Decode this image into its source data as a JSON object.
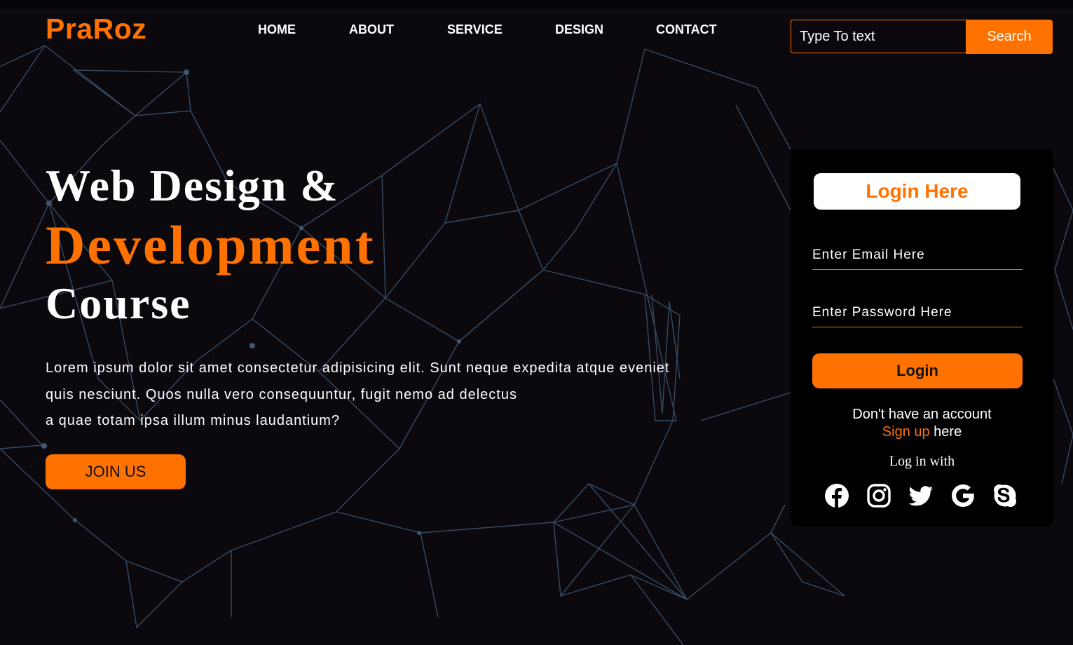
{
  "brand": {
    "logo": "PraRoz",
    "accent_color": "#ff7200"
  },
  "nav": {
    "items": [
      "HOME",
      "ABOUT",
      "SERVICE",
      "DESIGN",
      "CONTACT"
    ]
  },
  "search": {
    "placeholder": "Type To text",
    "button_label": "Search"
  },
  "hero": {
    "title_line1": "Web Design &",
    "title_line2": "Development",
    "title_line3": "Course",
    "paragraph_lines": [
      "Lorem ipsum dolor sit amet consectetur adipisicing elit. Sunt neque expedita atque eveniet",
      "quis nesciunt. Quos nulla vero consequuntur, fugit nemo ad delectus",
      "a quae totam ipsa illum minus laudantium?"
    ],
    "cta_label": "JOIN US"
  },
  "login": {
    "title": "Login Here",
    "email_placeholder": "Enter Email Here",
    "password_placeholder": "Enter Password Here",
    "button_label": "Login",
    "no_account_text": "Don't have an account",
    "signup_link": "Sign up",
    "signup_suffix": " here",
    "login_with": "Log in with",
    "social_icons": [
      "facebook-icon",
      "instagram-icon",
      "twitter-icon",
      "google-icon",
      "skype-icon"
    ]
  }
}
